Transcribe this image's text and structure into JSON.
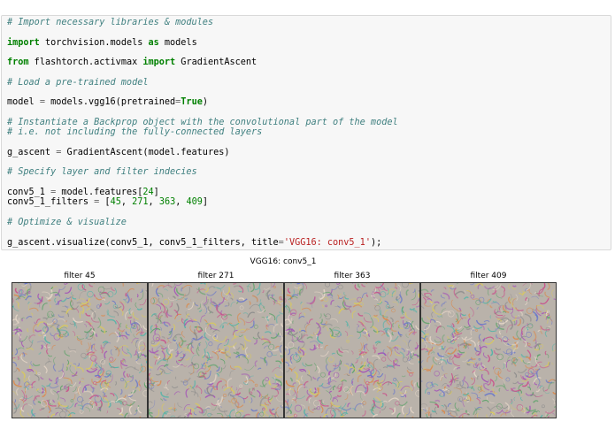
{
  "code_cell": {
    "lines": [
      [
        {
          "t": "cm",
          "v": "# Import necessary libraries & modules"
        }
      ],
      [],
      [
        {
          "t": "kw",
          "v": "import"
        },
        {
          "t": "",
          "v": " torchvision.models "
        },
        {
          "t": "kw",
          "v": "as"
        },
        {
          "t": "",
          "v": " models"
        }
      ],
      [],
      [
        {
          "t": "kw",
          "v": "from"
        },
        {
          "t": "",
          "v": " flashtorch.activmax "
        },
        {
          "t": "kw",
          "v": "import"
        },
        {
          "t": "",
          "v": " GradientAscent"
        }
      ],
      [],
      [
        {
          "t": "cm",
          "v": "# Load a pre-trained model"
        }
      ],
      [],
      [
        {
          "t": "",
          "v": "model "
        },
        {
          "t": "op",
          "v": "="
        },
        {
          "t": "",
          "v": " models.vgg16(pretrained"
        },
        {
          "t": "op",
          "v": "="
        },
        {
          "t": "kw",
          "v": "True"
        },
        {
          "t": "",
          "v": ")"
        }
      ],
      [],
      [
        {
          "t": "cm",
          "v": "# Instantiate a Backprop object with the convolutional part of the model"
        }
      ],
      [
        {
          "t": "cm",
          "v": "# i.e. not including the fully-connected layers"
        }
      ],
      [],
      [
        {
          "t": "",
          "v": "g_ascent "
        },
        {
          "t": "op",
          "v": "="
        },
        {
          "t": "",
          "v": " GradientAscent(model.features)"
        }
      ],
      [],
      [
        {
          "t": "cm",
          "v": "# Specify layer and filter indecies"
        }
      ],
      [],
      [
        {
          "t": "",
          "v": "conv5_1 "
        },
        {
          "t": "op",
          "v": "="
        },
        {
          "t": "",
          "v": " model.features["
        },
        {
          "t": "nm",
          "v": "24"
        },
        {
          "t": "",
          "v": "]"
        }
      ],
      [
        {
          "t": "",
          "v": "conv5_1_filters "
        },
        {
          "t": "op",
          "v": "="
        },
        {
          "t": "",
          "v": " ["
        },
        {
          "t": "nm",
          "v": "45"
        },
        {
          "t": "",
          "v": ", "
        },
        {
          "t": "nm",
          "v": "271"
        },
        {
          "t": "",
          "v": ", "
        },
        {
          "t": "nm",
          "v": "363"
        },
        {
          "t": "",
          "v": ", "
        },
        {
          "t": "nm",
          "v": "409"
        },
        {
          "t": "",
          "v": "]"
        }
      ],
      [],
      [
        {
          "t": "cm",
          "v": "# Optimize & visualize"
        }
      ],
      [],
      [
        {
          "t": "",
          "v": "g_ascent.visualize(conv5_1, conv5_1_filters, title"
        },
        {
          "t": "op",
          "v": "="
        },
        {
          "t": "st",
          "v": "'VGG16: conv5_1'"
        },
        {
          "t": "",
          "v": ");"
        }
      ]
    ]
  },
  "figure": {
    "title": "VGG16: conv5_1",
    "panels": [
      {
        "title": "filter 45",
        "seed": 45
      },
      {
        "title": "filter 271",
        "seed": 271
      },
      {
        "title": "filter 363",
        "seed": 363
      },
      {
        "title": "filter 409",
        "seed": 409
      }
    ]
  }
}
